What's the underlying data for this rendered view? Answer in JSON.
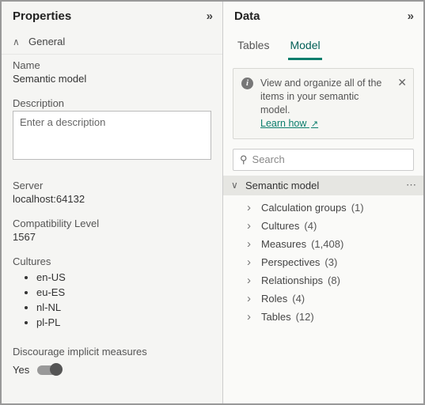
{
  "properties": {
    "title": "Properties",
    "general_header": "General",
    "name_label": "Name",
    "name_value": "Semantic model",
    "description_label": "Description",
    "description_placeholder": "Enter a description",
    "server_label": "Server",
    "server_value": "localhost:64132",
    "compat_label": "Compatibility Level",
    "compat_value": "1567",
    "cultures_label": "Cultures",
    "cultures": [
      "en-US",
      "eu-ES",
      "nl-NL",
      "pl-PL"
    ],
    "discourage_label": "Discourage implicit measures",
    "discourage_state": "Yes"
  },
  "data": {
    "title": "Data",
    "tabs": {
      "tables": "Tables",
      "model": "Model"
    },
    "banner": {
      "text": "View and organize all of the items in your semantic model.",
      "link_text": "Learn how"
    },
    "search_placeholder": "Search",
    "root_label": "Semantic model",
    "tree": [
      {
        "label": "Calculation groups",
        "count": "(1)"
      },
      {
        "label": "Cultures",
        "count": "(4)"
      },
      {
        "label": "Measures",
        "count": "(1,408)"
      },
      {
        "label": "Perspectives",
        "count": "(3)"
      },
      {
        "label": "Relationships",
        "count": "(8)"
      },
      {
        "label": "Roles",
        "count": "(4)"
      },
      {
        "label": "Tables",
        "count": "(12)"
      }
    ]
  }
}
